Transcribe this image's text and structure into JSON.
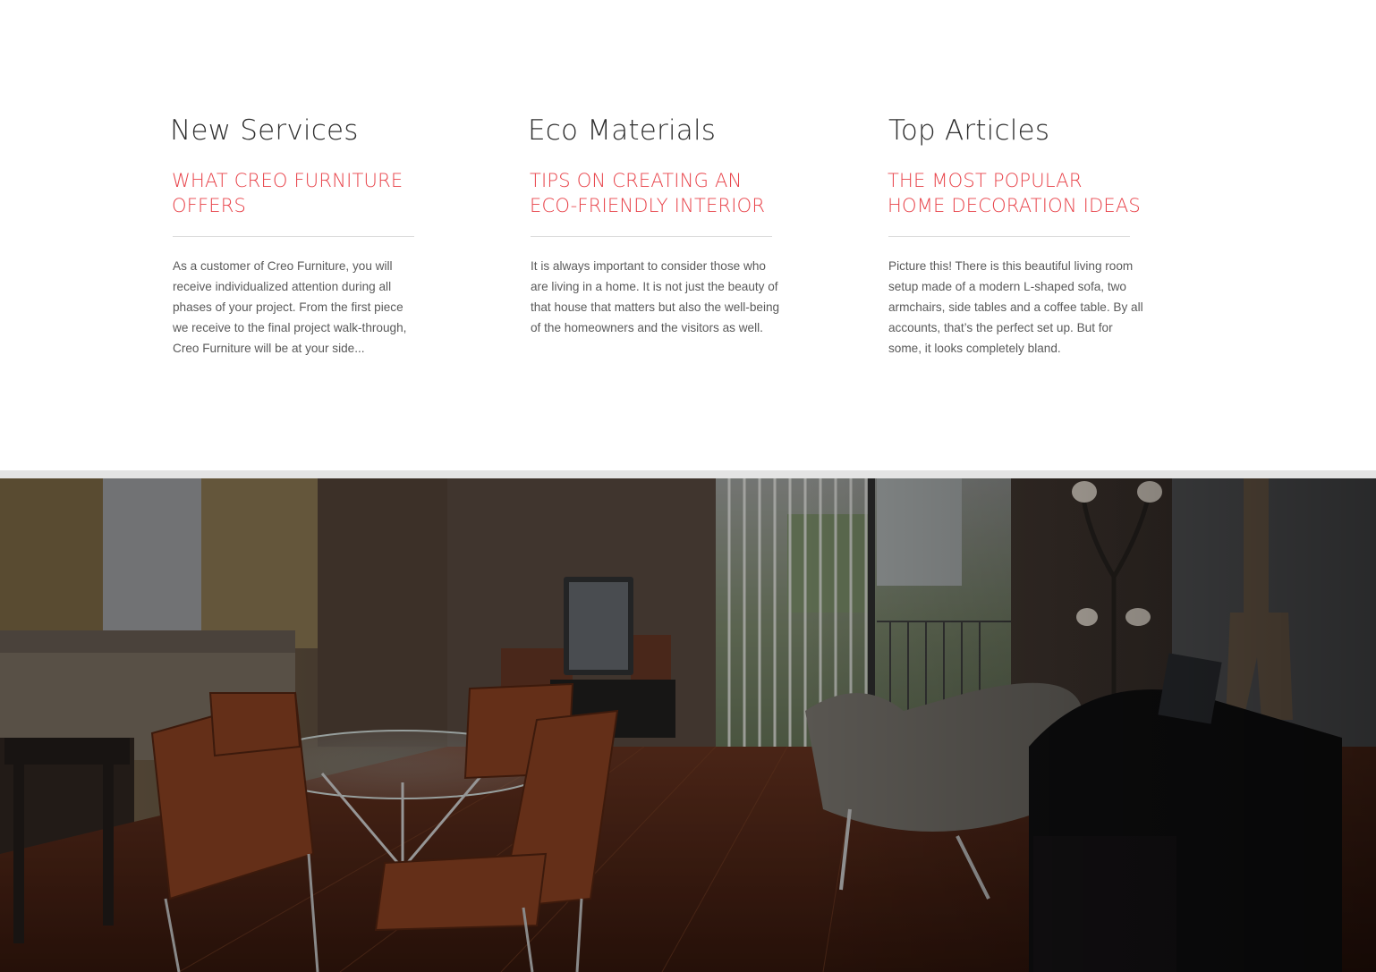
{
  "services": [
    {
      "title": "New Services",
      "subtitle_line1": "WHAT CREO FURNITURE",
      "subtitle_line2": "OFFERS",
      "text": "As a customer of Creo Furniture, you will receive individualized attention during all phases of your project.  From the first piece we receive to the final project walk-through, Creo Furniture will be at your side..."
    },
    {
      "title": "Eco Materials",
      "subtitle_line1": "TIPS ON CREATING AN",
      "subtitle_line2": "ECO-FRIENDLY INTERIOR",
      "text": "It is always important to consider those who are living in a home. It is not just the beauty of that house that matters but also the well-being of the homeowners and the visitors as well."
    },
    {
      "title": "Top Articles",
      "subtitle_line1": "THE MOST POPULAR",
      "subtitle_line2": "HOME DECORATION IDEAS",
      "text": "Picture this! There is this beautiful living room setup made of a modern L-shaped sofa, two armchairs, side tables and a coffee table. By all accounts, that’s the perfect set up. But for some, it looks completely bland."
    }
  ],
  "colors": {
    "accent": "#e8434a",
    "heading": "#2f2f2f",
    "body_text": "#5a5a5a",
    "rule": "#dcdcdc",
    "band": "#e4e4e4"
  }
}
